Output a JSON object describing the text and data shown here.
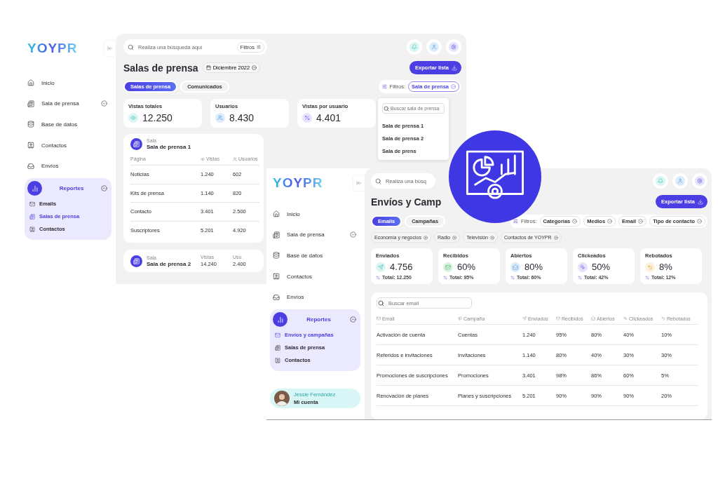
{
  "back_app": {
    "sidebar": {
      "logo": "YOYPR",
      "items": [
        {
          "label": "Inicio"
        },
        {
          "label": "Sala de prensa",
          "expanded": false
        },
        {
          "label": "Base de datos"
        },
        {
          "label": "Contactos"
        },
        {
          "label": "Envíos"
        }
      ],
      "group": {
        "label": "Reportes",
        "expanded": true,
        "children": [
          {
            "label": "Emails",
            "selected": false
          },
          {
            "label": "Salas de prensa",
            "selected": true
          },
          {
            "label": "Contactos",
            "selected": false
          }
        ]
      }
    },
    "search": {
      "placeholder": "Realiza una búsqueda aquí",
      "filters_button": "Filtros"
    },
    "title": "Salas de prensa",
    "date": "Diciembre 2022",
    "export_button": "Exportar lista",
    "tabs": [
      {
        "label": "Salas de prensa",
        "selected": true
      },
      {
        "label": "Comunicados",
        "selected": false
      }
    ],
    "filter_label": "Filtros:",
    "filter_chip": "Sala de prensa",
    "dropdown": {
      "placeholder": "Buscar sala de prensa",
      "options": [
        "Sala de prensa 1",
        "Sala de prensa 2",
        "Sala de prens"
      ]
    },
    "stats": [
      {
        "label": "Vistas totales",
        "value": "12.250"
      },
      {
        "label": "Usuarios",
        "value": "8.430"
      },
      {
        "label": "Vistas por usuario",
        "value": "4.401"
      }
    ],
    "room": {
      "caption": "Sala",
      "name": "Sala de prensa 1",
      "columns": [
        "Página",
        "Vistas",
        "Usuarios"
      ],
      "rows": [
        [
          "Noticias",
          "1.240",
          "602"
        ],
        [
          "Kits de prensa",
          "1.140",
          "820"
        ],
        [
          "Contacto",
          "3.401",
          "2.500"
        ],
        [
          "Suscriptores",
          "5.201",
          "4.920"
        ]
      ]
    },
    "room_2": {
      "caption": "Sala",
      "name": "Sala de prensa 2",
      "metrics": [
        {
          "label": "Vistas",
          "value": "14.240"
        },
        {
          "label": "Usu",
          "value": "2.400"
        }
      ]
    }
  },
  "front_app": {
    "sidebar": {
      "logo": "YOYPR",
      "items": [
        {
          "label": "Inicio"
        },
        {
          "label": "Sala de prensa",
          "expanded": false
        },
        {
          "label": "Base de datos"
        },
        {
          "label": "Contactos"
        },
        {
          "label": "Envíos"
        }
      ],
      "group": {
        "label": "Reportes",
        "expanded": true,
        "children": [
          {
            "label": "Envíos y campañas",
            "selected": true
          },
          {
            "label": "Salas de prensa",
            "selected": false
          },
          {
            "label": "Contactos",
            "selected": false
          }
        ]
      },
      "user": {
        "name": "Jessie Fernández",
        "subtitle": "Mi cuenta"
      }
    },
    "search": {
      "placeholder": "Realiza una búsq"
    },
    "title": "Envíos y Camp",
    "export_button": "Exportar lista",
    "tabs": [
      {
        "label": "Emails",
        "selected": true
      },
      {
        "label": "Campañas",
        "selected": false
      }
    ],
    "filter_label": "Filtros:",
    "filters": [
      "Categorías",
      "Medios",
      "Email",
      "Tipo de contacto"
    ],
    "tags": [
      "Economía y negocios",
      "Radio",
      "Televisión",
      "Contactos de YOYPR"
    ],
    "stats": [
      {
        "label": "Enviados",
        "value": "4.756",
        "total": "Total: 12.250"
      },
      {
        "label": "Recibidos",
        "value": "60%",
        "total": "Total: 95%"
      },
      {
        "label": "Abiertos",
        "value": "80%",
        "total": "Total: 60%"
      },
      {
        "label": "Clickeados",
        "value": "50%",
        "total": "Total: 42%"
      },
      {
        "label": "Rebotados",
        "value": "8%",
        "total": "Total: 12%"
      }
    ],
    "table": {
      "search_placeholder": "Buscar email",
      "columns": [
        "Email",
        "Campaña",
        "Enviados",
        "Recibidos",
        "Abiertos",
        "Clickeados",
        "Rebotados"
      ],
      "rows": [
        [
          "Activación de cuenta",
          "Cuentas",
          "1.240",
          "95%",
          "80%",
          "40%",
          "10%"
        ],
        [
          "Referidos e invitaciones",
          "Invitaciones",
          "1.140",
          "80%",
          "40%",
          "30%",
          "30%"
        ],
        [
          "Promociones de suscripciones",
          "Promociones",
          "3.401",
          "98%",
          "86%",
          "60%",
          "5%"
        ],
        [
          "Renovación de planes",
          "Planes y suscripciones",
          "5.201",
          "90%",
          "90%",
          "90%",
          "20%"
        ]
      ]
    }
  }
}
